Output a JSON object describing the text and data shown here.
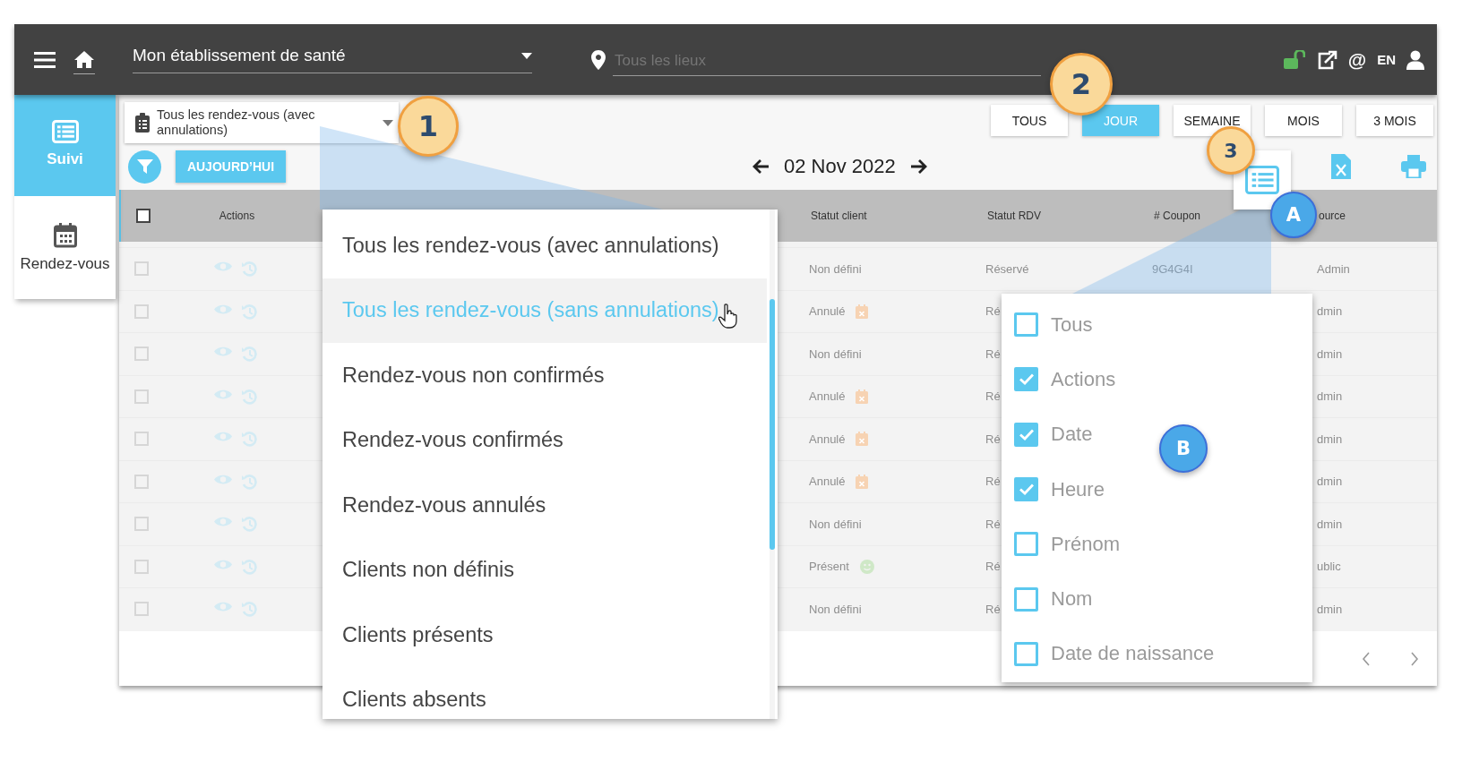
{
  "topbar": {
    "establishment": "Mon établissement de santé",
    "location_placeholder": "Tous les lieux",
    "email_symbol": "@",
    "language": "EN"
  },
  "sidebar": {
    "items": [
      {
        "label": "Suivi",
        "kind": "list",
        "selected": true
      },
      {
        "label": "Rendez-vous",
        "kind": "calendar",
        "selected": false
      }
    ]
  },
  "filter_select": {
    "value": "Tous les rendez-vous (avec annulations)"
  },
  "view_buttons": [
    {
      "label": "TOUS",
      "selected": false
    },
    {
      "label": "JOUR",
      "selected": true
    },
    {
      "label": "SEMAINE",
      "selected": false
    },
    {
      "label": "MOIS",
      "selected": false
    },
    {
      "label": "3 MOIS",
      "selected": false
    }
  ],
  "today_button": "AUJOURD’HUI",
  "date": "02 Nov 2022",
  "table": {
    "select_all": {
      "checked": false
    },
    "columns": [
      "Actions",
      "Statut client",
      "Statut RDV",
      "# Coupon",
      "ource"
    ],
    "rows": [
      {
        "checked": false,
        "client_status": "Non défini",
        "kind": "undefined",
        "rdv_status": "Réservé",
        "coupon": "9G4G4I",
        "source": "Admin"
      },
      {
        "checked": false,
        "client_status": "Annulé",
        "kind": "cancelled",
        "rdv_status": "Ré",
        "source": "dmin"
      },
      {
        "checked": false,
        "client_status": "Non défini",
        "kind": "undefined",
        "rdv_status": "Ré",
        "source": "dmin"
      },
      {
        "checked": false,
        "client_status": "Annulé",
        "kind": "cancelled",
        "rdv_status": "Ré",
        "source": "dmin"
      },
      {
        "checked": false,
        "client_status": "Annulé",
        "kind": "cancelled",
        "rdv_status": "Ré",
        "source": "dmin"
      },
      {
        "checked": false,
        "client_status": "Annulé",
        "kind": "cancelled",
        "rdv_status": "Ré",
        "source": "dmin"
      },
      {
        "checked": false,
        "client_status": "Non défini",
        "kind": "undefined",
        "rdv_status": "Ré",
        "source": "dmin"
      },
      {
        "checked": false,
        "client_status": "Présent",
        "kind": "present",
        "rdv_status": "Ré",
        "source": "ublic"
      },
      {
        "checked": false,
        "client_status": "Non défini",
        "kind": "undefined",
        "rdv_status": "Ré",
        "source": "dmin"
      }
    ]
  },
  "appointment_filter_menu": {
    "items": [
      {
        "label": "Tous les rendez-vous (avec annulations)",
        "highlighted": false
      },
      {
        "label": "Tous les rendez-vous (sans annulations)",
        "highlighted": true
      },
      {
        "label": "Rendez-vous non confirmés",
        "highlighted": false
      },
      {
        "label": "Rendez-vous confirmés",
        "highlighted": false
      },
      {
        "label": "Rendez-vous annulés",
        "highlighted": false
      },
      {
        "label": "Clients non définis",
        "highlighted": false
      },
      {
        "label": "Clients présents",
        "highlighted": false
      },
      {
        "label": "Clients absents",
        "highlighted": false
      }
    ]
  },
  "column_menu": {
    "items": [
      {
        "label": "Tous",
        "checked": false
      },
      {
        "label": "Actions",
        "checked": true
      },
      {
        "label": "Date",
        "checked": true
      },
      {
        "label": "Heure",
        "checked": true
      },
      {
        "label": "Prénom",
        "checked": false
      },
      {
        "label": "Nom",
        "checked": false
      },
      {
        "label": "Date de naissance",
        "checked": false
      }
    ]
  },
  "callouts": [
    {
      "label": "1",
      "kind": "step"
    },
    {
      "label": "2",
      "kind": "step"
    },
    {
      "label": "3",
      "kind": "step"
    },
    {
      "label": "A",
      "kind": "marker"
    },
    {
      "label": "B",
      "kind": "marker"
    }
  ]
}
